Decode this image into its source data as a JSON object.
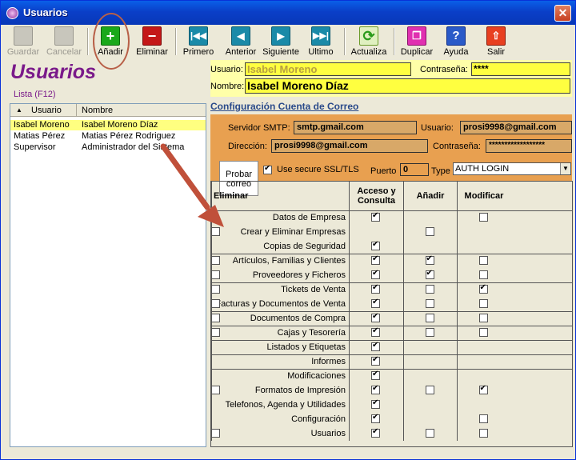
{
  "window": {
    "title": "Usuarios",
    "close": "✕"
  },
  "toolbar": {
    "guardar": "Guardar",
    "cancelar": "Cancelar",
    "anadir": "Añadir",
    "eliminar": "Eliminar",
    "primero": "Primero",
    "anterior": "Anterior",
    "siguiente": "Siguiente",
    "ultimo": "Ultimo",
    "actualiza": "Actualiza",
    "duplicar": "Duplicar",
    "ayuda": "Ayuda",
    "salir": "Salir"
  },
  "heading": "Usuarios",
  "list": {
    "label": "Lista (F12)",
    "col_usuario": "Usuario",
    "col_nombre": "Nombre",
    "rows": [
      {
        "usuario": "Isabel Moreno",
        "nombre": "Isabel Moreno Díaz",
        "selected": true
      },
      {
        "usuario": "Matias Pérez",
        "nombre": "Matias Pérez Rodriguez",
        "selected": false
      },
      {
        "usuario": "Supervisor",
        "nombre": "Administrador del Sistema",
        "selected": false
      }
    ]
  },
  "form": {
    "usuario_label": "Usuario:",
    "usuario_value": "Isabel Moreno",
    "contrasena_label": "Contraseña:",
    "contrasena_value": "****",
    "nombre_label": "Nombre:",
    "nombre_value": "Isabel Moreno Díaz"
  },
  "email": {
    "title": "Configuración Cuenta de Correo",
    "smtp_label": "Servidor SMTP:",
    "smtp_value": "smtp.gmail.com",
    "usuario_label": "Usuario:",
    "usuario_value": "prosi9998@gmail.com",
    "direccion_label": "Dirección:",
    "direccion_value": "prosi9998@gmail.com",
    "contrasena_label": "Contraseña:",
    "contrasena_value": "******************",
    "probar": "Probar correo",
    "ssl_label": "Use secure SSL/TLS",
    "puerto_label": "Puerto",
    "puerto_value": "0",
    "type_label": "Type",
    "type_value": "AUTH LOGIN"
  },
  "permissions": {
    "headers": [
      "Acceso y Consulta",
      "Añadir",
      "Modificar",
      "Eliminar"
    ],
    "groups": [
      {
        "rows": [
          {
            "label": "Datos de Empresa",
            "c": [
              true,
              null,
              false,
              null
            ]
          },
          {
            "label": "Crear y Eliminar Empresas",
            "c": [
              null,
              false,
              null,
              false
            ]
          },
          {
            "label": "Copias de Seguridad",
            "c": [
              true,
              null,
              null,
              null
            ]
          }
        ]
      },
      {
        "rows": [
          {
            "label": "Artículos, Familias y Clientes",
            "c": [
              true,
              true,
              false,
              false
            ]
          },
          {
            "label": "Proveedores y Ficheros",
            "c": [
              true,
              true,
              false,
              false
            ]
          }
        ]
      },
      {
        "rows": [
          {
            "label": "Tickets de Venta",
            "c": [
              true,
              false,
              true,
              false
            ]
          },
          {
            "label": "Facturas y Documentos de Venta",
            "c": [
              true,
              false,
              false,
              false
            ]
          }
        ]
      },
      {
        "rows": [
          {
            "label": "Documentos de Compra",
            "c": [
              true,
              false,
              false,
              false
            ]
          }
        ]
      },
      {
        "rows": [
          {
            "label": "Cajas y Tesorería",
            "c": [
              true,
              false,
              false,
              false
            ]
          }
        ]
      },
      {
        "rows": [
          {
            "label": "Listados y Etiquetas",
            "c": [
              true,
              null,
              null,
              null
            ]
          }
        ]
      },
      {
        "rows": [
          {
            "label": "Informes",
            "c": [
              true,
              null,
              null,
              null
            ]
          }
        ]
      },
      {
        "rows": [
          {
            "label": "Modificaciones",
            "c": [
              true,
              null,
              null,
              null
            ]
          },
          {
            "label": "Formatos de Impresión",
            "c": [
              true,
              false,
              true,
              false
            ]
          },
          {
            "label": "Telefonos, Agenda y Utilidades",
            "c": [
              true,
              null,
              null,
              null
            ]
          },
          {
            "label": "Configuración",
            "c": [
              true,
              null,
              false,
              null
            ]
          },
          {
            "label": "Usuarios",
            "c": [
              true,
              false,
              false,
              false
            ]
          }
        ]
      }
    ]
  },
  "colors": {
    "annotation": "#c0503a",
    "highlight": "#ffff40",
    "config_bg": "#e8a050",
    "accent_purple": "#7a1a8a"
  }
}
